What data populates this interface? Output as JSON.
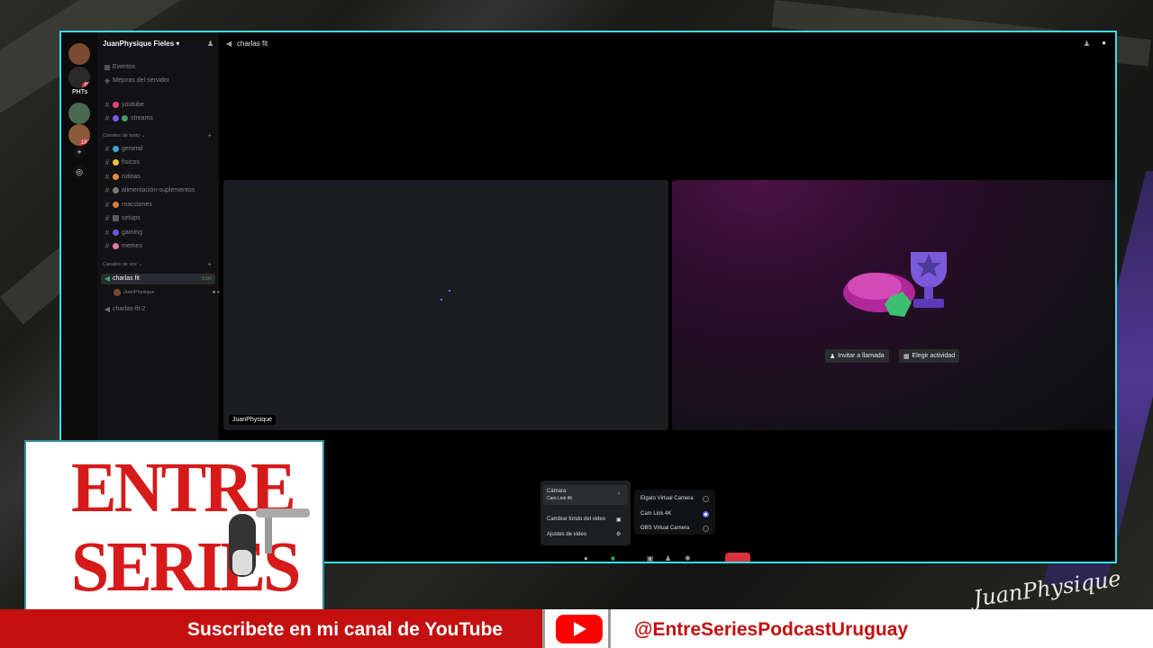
{
  "server": {
    "name": "JuanPhysique Fieles"
  },
  "rail": {
    "label": "PHTs",
    "badge1": "96",
    "badge2": "187"
  },
  "sidebar": {
    "top": [
      "Eventos",
      "Mejoras del servidor"
    ],
    "pinned": [
      {
        "label": "youtube",
        "color": "#e24a6b"
      },
      {
        "label": "streams",
        "color": "#7a5cf0"
      }
    ],
    "text_category": "Canales de texto",
    "text_channels": [
      {
        "label": "general",
        "color": "#46a0e0"
      },
      {
        "label": "físicos",
        "color": "#f0c040"
      },
      {
        "label": "rutinas",
        "color": "#e08a3a"
      },
      {
        "label": "alimentación-suplementos",
        "color": "#7a7a7a"
      },
      {
        "label": "reacciones",
        "color": "#e0783a"
      },
      {
        "label": "setups",
        "color": "#5a5a5a"
      },
      {
        "label": "gaming",
        "color": "#6a5ad8"
      },
      {
        "label": "memes",
        "color": "#e07aa0"
      }
    ],
    "voice_category": "Canales de voz",
    "voice_active": {
      "label": "charlas fit",
      "timer": "5:00"
    },
    "voice_user": "JuanPhysique",
    "voice_other": "charlas-fit-2"
  },
  "topbar": {
    "title": "charlas fit"
  },
  "tiles": {
    "name_tag": "JuanPhysique",
    "invite_label": "Invitar a llamada",
    "activity_label": "Elegir actividad"
  },
  "camera_menu": {
    "camera_label": "Cámara",
    "camera_sub": "Cam Link 4K",
    "background_label": "Cambiar fondo del video",
    "settings_label": "Ajustes de video",
    "devices": [
      {
        "label": "Elgato Virtual Camera",
        "selected": false
      },
      {
        "label": "Cam Link 4K",
        "selected": true
      },
      {
        "label": "OBS Virtual Camera",
        "selected": false
      }
    ]
  },
  "overlay": {
    "logo_line1": "ENTRE",
    "logo_line2": "SERIES",
    "banner_left": "Suscribete en mi canal de YouTube",
    "banner_right": "@EntreSeriesPodcastUruguay",
    "signature": "JuanPhysique"
  },
  "colors": {
    "accent": "#36e0ea",
    "banner_red": "#c40f0f",
    "brand_red": "#d61a1a",
    "discord_blurple": "#5865f2"
  }
}
